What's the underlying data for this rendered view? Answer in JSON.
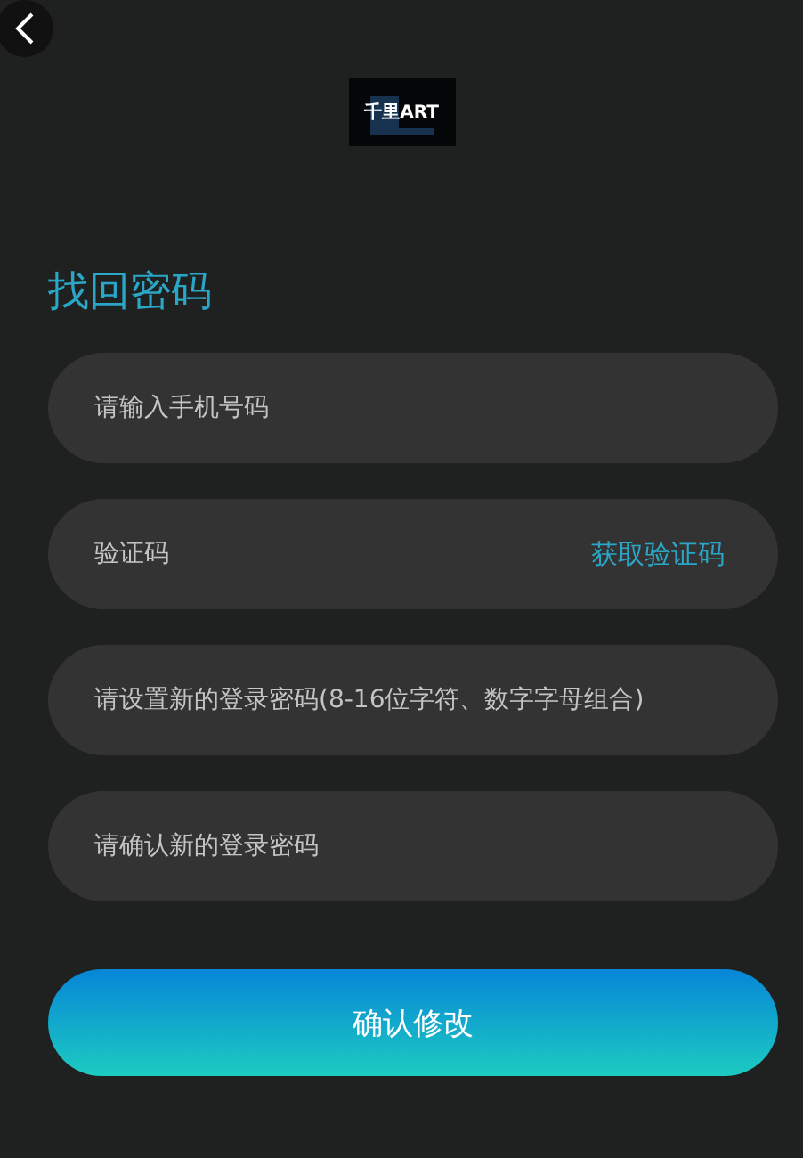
{
  "logo": "千里ART",
  "title": "找回密码",
  "fields": [
    {
      "kind": "text",
      "placeholder": "请输入手机号码"
    },
    {
      "kind": "code",
      "placeholder": "验证码",
      "action": "获取验证码"
    },
    {
      "kind": "text",
      "placeholder": "请设置新的登录密码(8-16位字符、数字字母组合)"
    },
    {
      "kind": "text",
      "placeholder": "请确认新的登录密码"
    }
  ],
  "submit": "确认修改"
}
